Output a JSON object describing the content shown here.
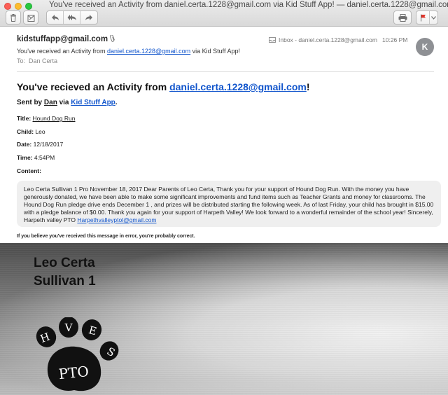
{
  "window": {
    "title": "You've received an Activity from daniel.certa.1228@gmail.com via Kid Stuff App! — daniel.certa.1228@gmail.com"
  },
  "toolbar": {
    "icons": [
      "trash-icon",
      "junk-icon",
      "reply-icon",
      "reply-all-icon",
      "forward-icon",
      "print-icon",
      "flag-icon",
      "chevron-down-icon"
    ],
    "flag_color": "#e0342a"
  },
  "header": {
    "sender": "kidstuffapp@gmail.com",
    "mailbox": "Inbox - daniel.certa.1228@gmail.com",
    "time": "10:26 PM",
    "avatar_initial": "K",
    "subject_prefix": "You've received an Activity from ",
    "subject_email": "daniel.certa.1228@gmail.com",
    "subject_suffix": " via Kid Stuff App!",
    "to_label": "To:",
    "to_name": "Dan Certa"
  },
  "body": {
    "headline_prefix": "You've recieved an Activity from ",
    "headline_email": "daniel.certa.1228@gmail.com",
    "headline_suffix": "!",
    "sentby_prefix": "Sent by ",
    "sentby_name": "Dan",
    "sentby_via": " via ",
    "sentby_app": "Kid Stuff App",
    "sentby_suffix": ".",
    "fields": {
      "title_label": "Title:",
      "title_value": "Hound Dog Run",
      "child_label": "Child:",
      "child_value": "Leo",
      "date_label": "Date:",
      "date_value": "12/18/2017",
      "time_label": "Time:",
      "time_value": "4:54PM",
      "content_label": "Content:"
    },
    "content_text": "Leo Certa Sullivan 1 Pro November 18, 2017 Dear Parents of Leo Certa, Thank you for your support of Hound Dog Run. With the money you have generously donated, we have been able to make some significant improvements and fund items such as Teacher Grants and money for classrooms. The Hound Dog Run pledge drive ends December 1 , and prizes will be distributed starting the following week. As of last Friday, your child has brought in $15.00 with a pledge balance of $0.00. Thank you again for your support of Harpeth Valley! We look forward to a wonderful remainder of the school year! Sincerely, Harpeth valley PTO ",
    "content_email": "Harpethvalleyptol@gmail.com",
    "footer_note": "If you believe you've received this message in error, you're probably correct."
  },
  "photo": {
    "line1": "Leo Certa",
    "line2": "Sullivan 1",
    "logo_letters": [
      "H",
      "V",
      "E",
      "S"
    ],
    "logo_text": "PTO"
  }
}
